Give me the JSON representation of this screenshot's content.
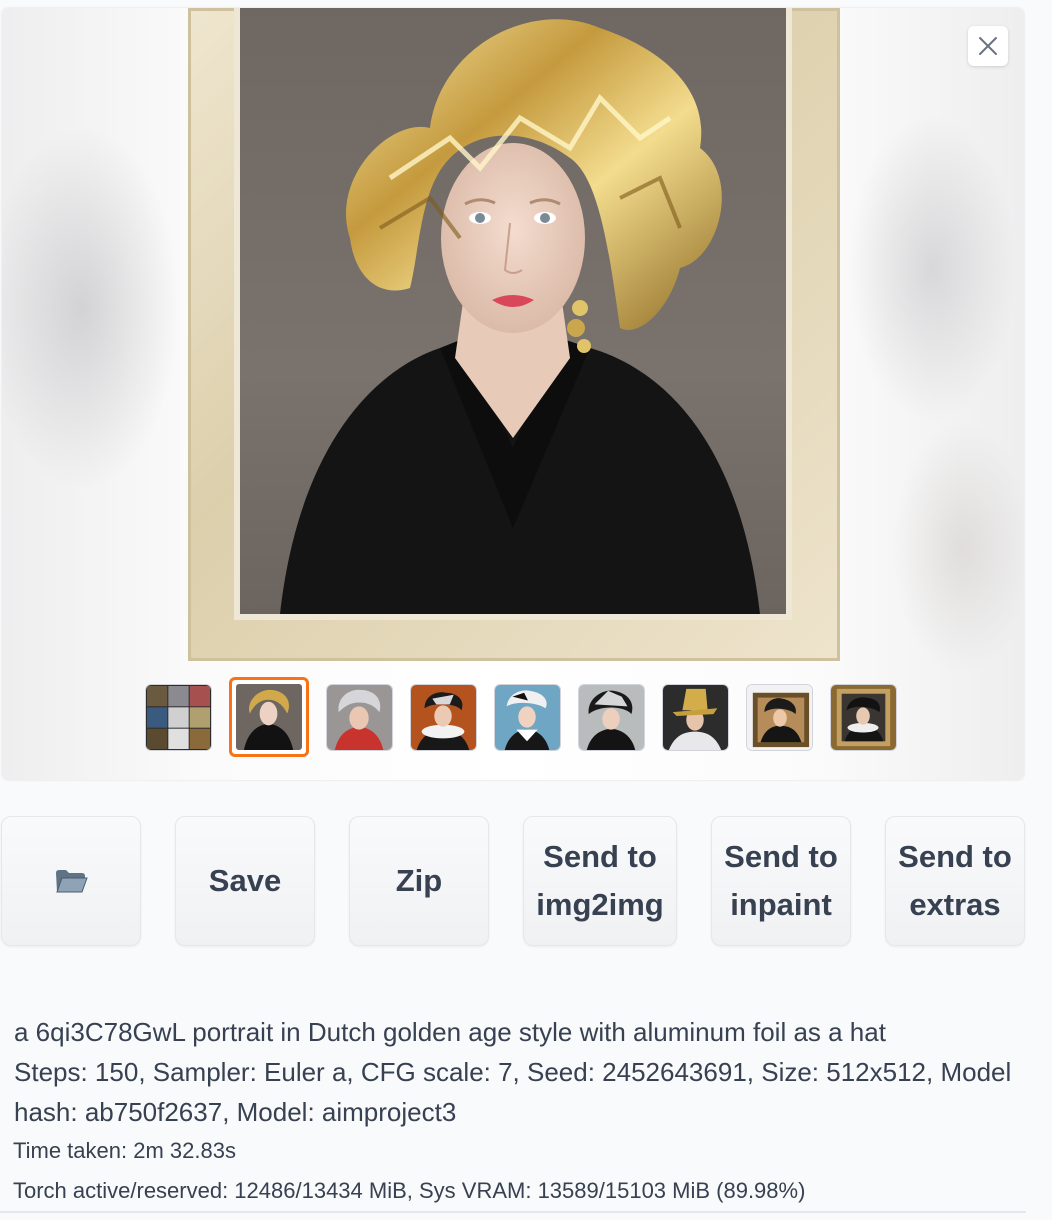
{
  "gallery": {
    "close_label": "close-icon",
    "thumbnail_count": 9,
    "selected_index": 1
  },
  "buttons": {
    "folder_icon": "folder-icon",
    "save": "Save",
    "zip": "Zip",
    "send_img2img_line1": "Send to",
    "send_img2img_line2": "img2img",
    "send_inpaint_line1": "Send to",
    "send_inpaint_line2": "inpaint",
    "send_extras_line1": "Send to",
    "send_extras_line2": "extras"
  },
  "generation_info": {
    "prompt": "a 6qi3C78GwL portrait in Dutch golden age style with aluminum foil as a hat",
    "params_line1": "Steps: 150, Sampler: Euler a, CFG scale: 7, Seed: 2452643691, Size: 512x512, Model",
    "params_line2": "hash: ab750f2637, Model: aimproject3",
    "time_taken": "Time taken: 2m 32.83s",
    "vram": "Torch active/reserved: 12486/13434 MiB, Sys VRAM: 13589/15103 MiB (89.98%)"
  },
  "colors": {
    "selected_thumb_border": "#f97316",
    "button_bg": "#f3f4f6",
    "text": "#374151"
  }
}
